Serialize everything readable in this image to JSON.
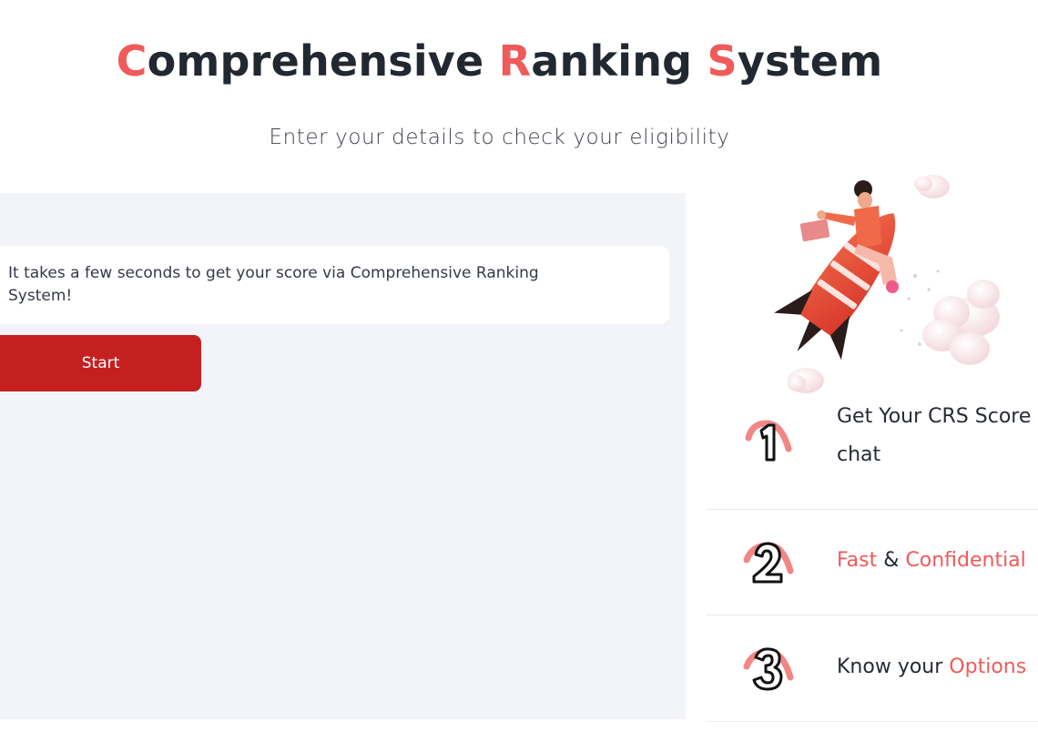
{
  "header": {
    "title_parts": [
      {
        "accent": "C",
        "rest": "omprehensive "
      },
      {
        "accent": "R",
        "rest": "anking "
      },
      {
        "accent": "S",
        "rest": "ystem"
      }
    ],
    "subtitle": "Enter your details to check your eligibility"
  },
  "chat": {
    "message": "It takes a few seconds to get your score via Comprehensive Ranking System!",
    "start_label": "Start"
  },
  "illustration": {
    "icon": "rocket-rider-illustration"
  },
  "steps": [
    {
      "number": "1",
      "line1": "Get Your CRS Score",
      "line2": "chat"
    },
    {
      "number": "2",
      "part_a": "Fast",
      "amp": "&",
      "part_b": "Confidential"
    },
    {
      "number": "3",
      "part_a": "Know your",
      "part_b": "Options"
    }
  ],
  "colors": {
    "accent": "#f05a5a",
    "button": "#c52020",
    "panel": "#f3f4f9",
    "text": "#222831"
  }
}
